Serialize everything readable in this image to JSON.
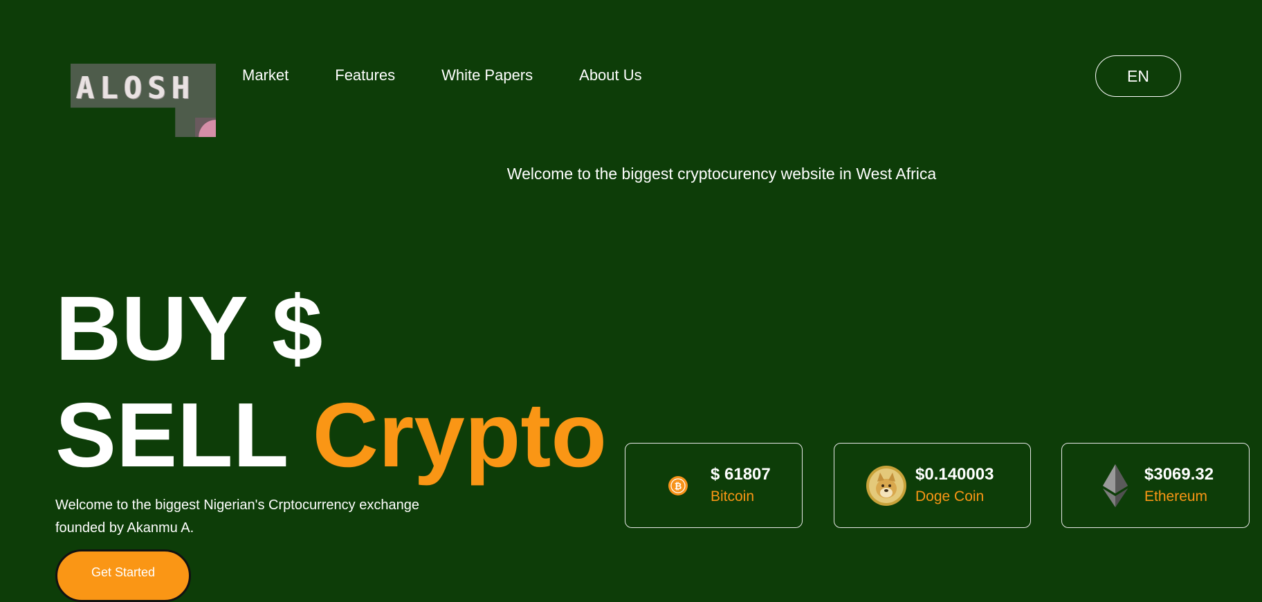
{
  "brand": {
    "logo_text": "ALOSH"
  },
  "nav": {
    "items": [
      {
        "label": "Market"
      },
      {
        "label": "Features"
      },
      {
        "label": "White Papers"
      },
      {
        "label": "About Us"
      }
    ]
  },
  "language": {
    "label": "EN"
  },
  "banner": {
    "text": "Welcome to the biggest cryptocurency website in West Africa"
  },
  "hero": {
    "line1": "BUY $",
    "line2_word": "SELL",
    "line2_accent": "Crypto",
    "subtitle": "Welcome to the biggest Nigerian's Crptocurrency exchange founded by Akanmu A.",
    "cta_label": "Get Started"
  },
  "coins": [
    {
      "price": "$ 61807",
      "name": "Bitcoin",
      "icon": "bitcoin-icon"
    },
    {
      "price": "$0.140003",
      "name": "Doge Coin",
      "icon": "dogecoin-icon"
    },
    {
      "price": "$3069.32",
      "name": "Ethereum",
      "icon": "ethereum-icon"
    }
  ],
  "colors": {
    "background": "#0d3d08",
    "accent": "#fa9615",
    "text": "#ffffff"
  }
}
